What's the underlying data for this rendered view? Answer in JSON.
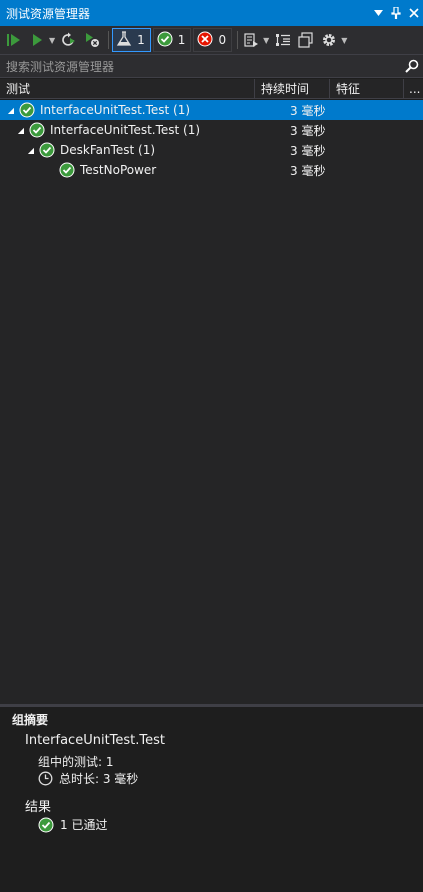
{
  "window": {
    "title": "测试资源管理器",
    "dropdown_icon": "chevron-down-icon",
    "pin_icon": "pin-icon",
    "close_icon": "close-icon"
  },
  "toolbar": {
    "run_all_icon": "run-all-icon",
    "run_icon": "run-icon",
    "rerun_icon": "repeat-run-icon",
    "cancel_icon": "cancel-icon",
    "filters": [
      {
        "icon": "flask-icon",
        "count": "1",
        "active": true
      },
      {
        "icon": "passed-icon",
        "count": "1",
        "active": false
      },
      {
        "icon": "failed-icon",
        "count": "0",
        "active": false
      }
    ],
    "playlist_icon": "playlist-icon",
    "group_by_icon": "group-by-icon",
    "columns_icon": "columns-icon",
    "settings_icon": "gear-icon"
  },
  "search": {
    "placeholder": "搜索测试资源管理器",
    "icon": "search-icon"
  },
  "columns": {
    "test": "测试",
    "duration": "持续时间",
    "traits": "特征",
    "more": "..."
  },
  "tree": [
    {
      "name": "InterfaceUnitTest.Test (1)",
      "duration": "3 毫秒",
      "level": 0,
      "expanded": true,
      "selected": true
    },
    {
      "name": "InterfaceUnitTest.Test (1)",
      "duration": "3 毫秒",
      "level": 1,
      "expanded": true,
      "selected": false
    },
    {
      "name": "DeskFanTest (1)",
      "duration": "3 毫秒",
      "level": 2,
      "expanded": true,
      "selected": false
    },
    {
      "name": "TestNoPower",
      "duration": "3 毫秒",
      "level": 3,
      "expanded": false,
      "selected": false
    }
  ],
  "summary": {
    "title": "组摘要",
    "group_name": "InterfaceUnitTest.Test",
    "tests_in_group": "组中的测试: 1",
    "total_duration": "总时长: 3 毫秒",
    "results_label": "结果",
    "passed_text": "1 已通过"
  },
  "colors": {
    "accent": "#007acc",
    "passed": "#3c9a3c",
    "failed": "#e51400"
  }
}
